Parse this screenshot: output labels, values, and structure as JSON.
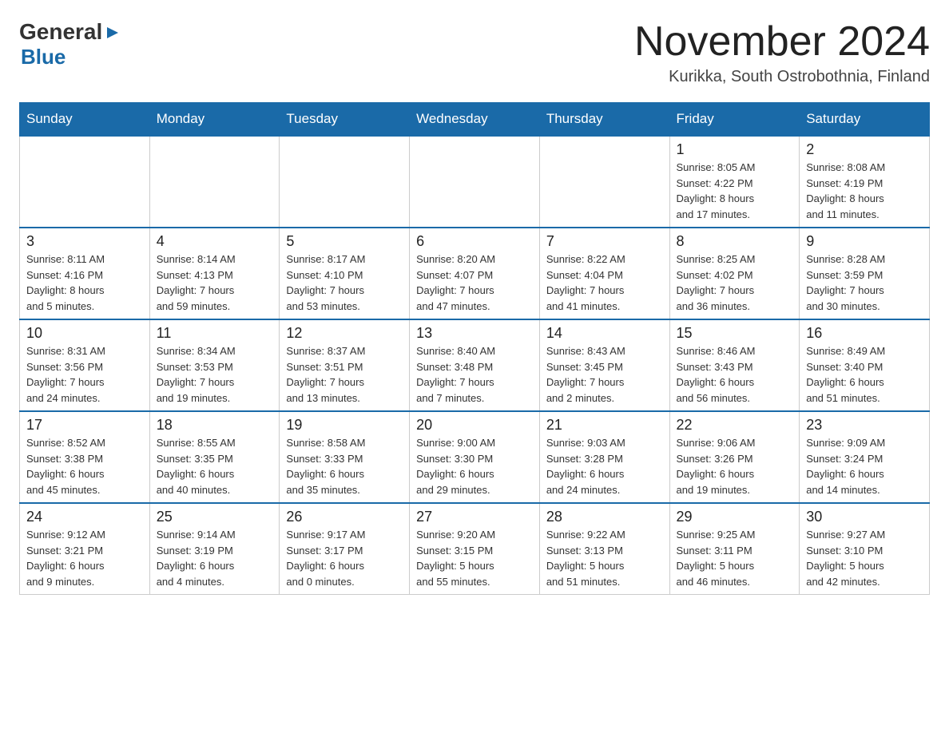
{
  "logo": {
    "general": "General",
    "arrow": "▶",
    "blue": "Blue"
  },
  "title": "November 2024",
  "subtitle": "Kurikka, South Ostrobothnia, Finland",
  "headers": [
    "Sunday",
    "Monday",
    "Tuesday",
    "Wednesday",
    "Thursday",
    "Friday",
    "Saturday"
  ],
  "weeks": [
    [
      {
        "day": "",
        "info": ""
      },
      {
        "day": "",
        "info": ""
      },
      {
        "day": "",
        "info": ""
      },
      {
        "day": "",
        "info": ""
      },
      {
        "day": "",
        "info": ""
      },
      {
        "day": "1",
        "info": "Sunrise: 8:05 AM\nSunset: 4:22 PM\nDaylight: 8 hours\nand 17 minutes."
      },
      {
        "day": "2",
        "info": "Sunrise: 8:08 AM\nSunset: 4:19 PM\nDaylight: 8 hours\nand 11 minutes."
      }
    ],
    [
      {
        "day": "3",
        "info": "Sunrise: 8:11 AM\nSunset: 4:16 PM\nDaylight: 8 hours\nand 5 minutes."
      },
      {
        "day": "4",
        "info": "Sunrise: 8:14 AM\nSunset: 4:13 PM\nDaylight: 7 hours\nand 59 minutes."
      },
      {
        "day": "5",
        "info": "Sunrise: 8:17 AM\nSunset: 4:10 PM\nDaylight: 7 hours\nand 53 minutes."
      },
      {
        "day": "6",
        "info": "Sunrise: 8:20 AM\nSunset: 4:07 PM\nDaylight: 7 hours\nand 47 minutes."
      },
      {
        "day": "7",
        "info": "Sunrise: 8:22 AM\nSunset: 4:04 PM\nDaylight: 7 hours\nand 41 minutes."
      },
      {
        "day": "8",
        "info": "Sunrise: 8:25 AM\nSunset: 4:02 PM\nDaylight: 7 hours\nand 36 minutes."
      },
      {
        "day": "9",
        "info": "Sunrise: 8:28 AM\nSunset: 3:59 PM\nDaylight: 7 hours\nand 30 minutes."
      }
    ],
    [
      {
        "day": "10",
        "info": "Sunrise: 8:31 AM\nSunset: 3:56 PM\nDaylight: 7 hours\nand 24 minutes."
      },
      {
        "day": "11",
        "info": "Sunrise: 8:34 AM\nSunset: 3:53 PM\nDaylight: 7 hours\nand 19 minutes."
      },
      {
        "day": "12",
        "info": "Sunrise: 8:37 AM\nSunset: 3:51 PM\nDaylight: 7 hours\nand 13 minutes."
      },
      {
        "day": "13",
        "info": "Sunrise: 8:40 AM\nSunset: 3:48 PM\nDaylight: 7 hours\nand 7 minutes."
      },
      {
        "day": "14",
        "info": "Sunrise: 8:43 AM\nSunset: 3:45 PM\nDaylight: 7 hours\nand 2 minutes."
      },
      {
        "day": "15",
        "info": "Sunrise: 8:46 AM\nSunset: 3:43 PM\nDaylight: 6 hours\nand 56 minutes."
      },
      {
        "day": "16",
        "info": "Sunrise: 8:49 AM\nSunset: 3:40 PM\nDaylight: 6 hours\nand 51 minutes."
      }
    ],
    [
      {
        "day": "17",
        "info": "Sunrise: 8:52 AM\nSunset: 3:38 PM\nDaylight: 6 hours\nand 45 minutes."
      },
      {
        "day": "18",
        "info": "Sunrise: 8:55 AM\nSunset: 3:35 PM\nDaylight: 6 hours\nand 40 minutes."
      },
      {
        "day": "19",
        "info": "Sunrise: 8:58 AM\nSunset: 3:33 PM\nDaylight: 6 hours\nand 35 minutes."
      },
      {
        "day": "20",
        "info": "Sunrise: 9:00 AM\nSunset: 3:30 PM\nDaylight: 6 hours\nand 29 minutes."
      },
      {
        "day": "21",
        "info": "Sunrise: 9:03 AM\nSunset: 3:28 PM\nDaylight: 6 hours\nand 24 minutes."
      },
      {
        "day": "22",
        "info": "Sunrise: 9:06 AM\nSunset: 3:26 PM\nDaylight: 6 hours\nand 19 minutes."
      },
      {
        "day": "23",
        "info": "Sunrise: 9:09 AM\nSunset: 3:24 PM\nDaylight: 6 hours\nand 14 minutes."
      }
    ],
    [
      {
        "day": "24",
        "info": "Sunrise: 9:12 AM\nSunset: 3:21 PM\nDaylight: 6 hours\nand 9 minutes."
      },
      {
        "day": "25",
        "info": "Sunrise: 9:14 AM\nSunset: 3:19 PM\nDaylight: 6 hours\nand 4 minutes."
      },
      {
        "day": "26",
        "info": "Sunrise: 9:17 AM\nSunset: 3:17 PM\nDaylight: 6 hours\nand 0 minutes."
      },
      {
        "day": "27",
        "info": "Sunrise: 9:20 AM\nSunset: 3:15 PM\nDaylight: 5 hours\nand 55 minutes."
      },
      {
        "day": "28",
        "info": "Sunrise: 9:22 AM\nSunset: 3:13 PM\nDaylight: 5 hours\nand 51 minutes."
      },
      {
        "day": "29",
        "info": "Sunrise: 9:25 AM\nSunset: 3:11 PM\nDaylight: 5 hours\nand 46 minutes."
      },
      {
        "day": "30",
        "info": "Sunrise: 9:27 AM\nSunset: 3:10 PM\nDaylight: 5 hours\nand 42 minutes."
      }
    ]
  ]
}
